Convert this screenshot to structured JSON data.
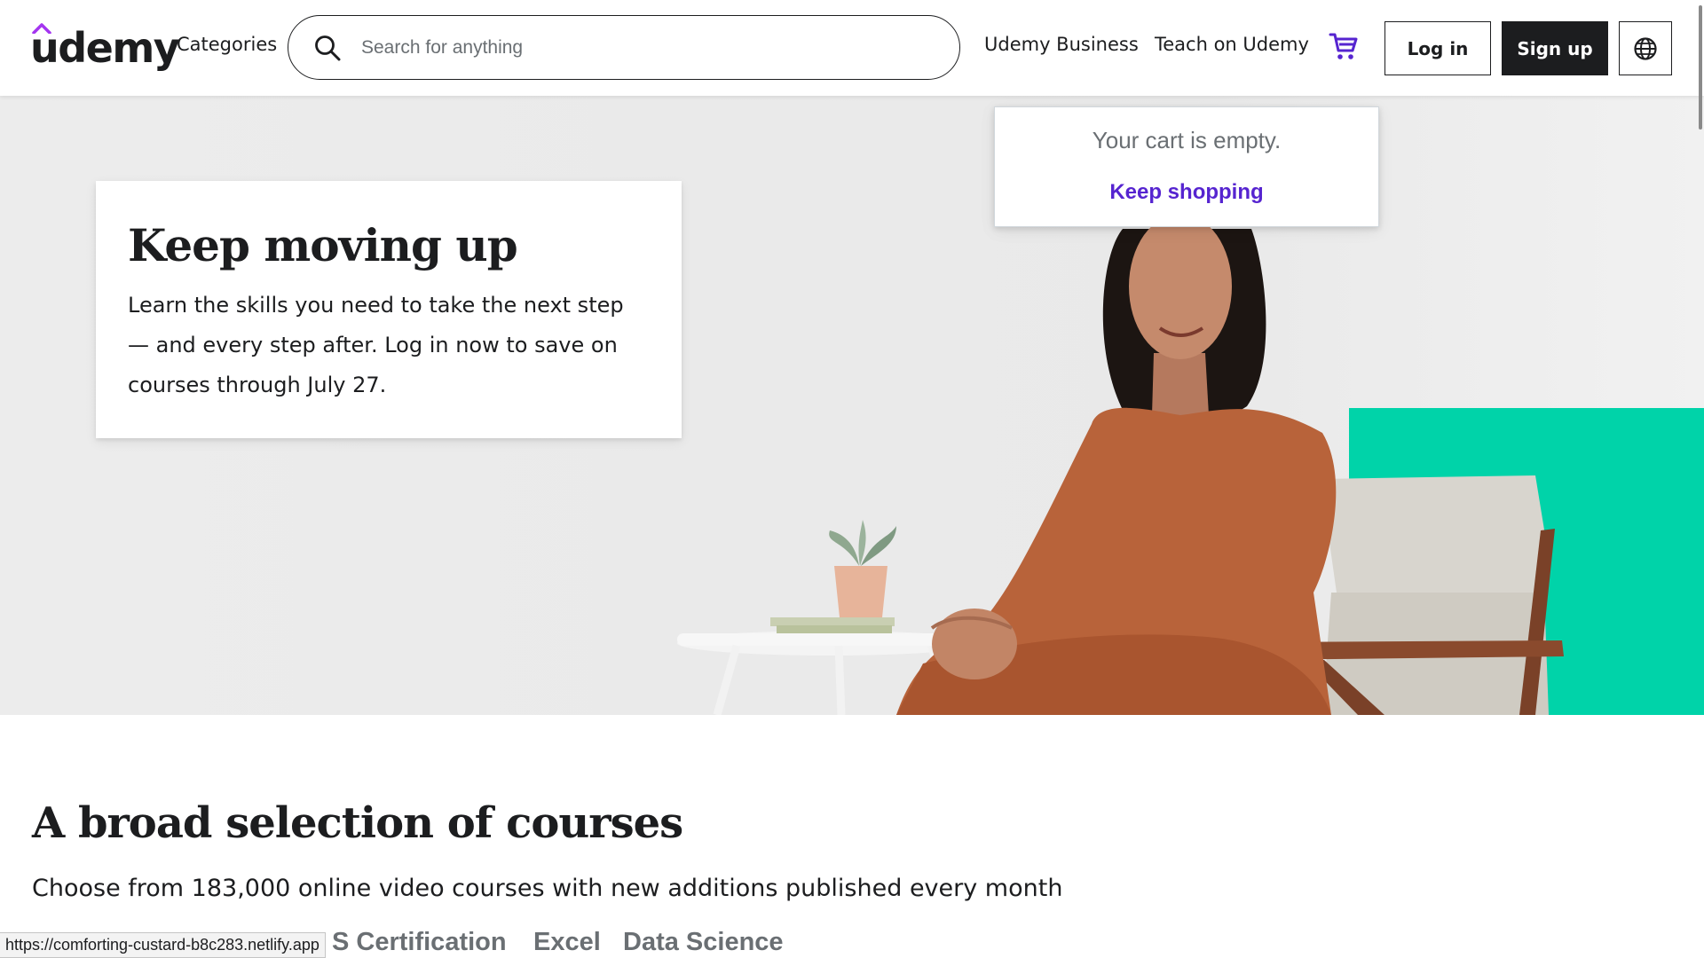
{
  "header": {
    "logo_text": "udemy",
    "categories_label": "Categories",
    "search": {
      "placeholder": "Search for anything",
      "value": ""
    },
    "udemy_business_label": "Udemy Business",
    "teach_label": "Teach on Udemy",
    "cart_icon": "cart-icon",
    "login_label": "Log in",
    "signup_label": "Sign up",
    "language_icon": "globe-icon"
  },
  "cart_popup": {
    "empty_text": "Your cart is empty.",
    "keep_shopping_label": "Keep shopping"
  },
  "hero": {
    "title": "Keep moving up",
    "text": "Learn the skills you need to take the next step — and every step after. Log in now to save on courses through July 27."
  },
  "courses": {
    "title": "A broad selection of courses",
    "subtitle": "Choose from 183,000 online video courses with new additions published every month",
    "tabs": [
      "S Certification",
      "Excel",
      "Data Science"
    ]
  },
  "status_url": "https://comforting-custard-b8c283.netlify.app",
  "colors": {
    "brand_purple": "#5624d0",
    "logo_accent": "#a435f0",
    "text_dark": "#1c1d1f",
    "text_muted": "#6a6f73",
    "hero_bg": "#ececec",
    "hero_accent_teal": "#00d3a9",
    "dress": "#b8633a"
  }
}
